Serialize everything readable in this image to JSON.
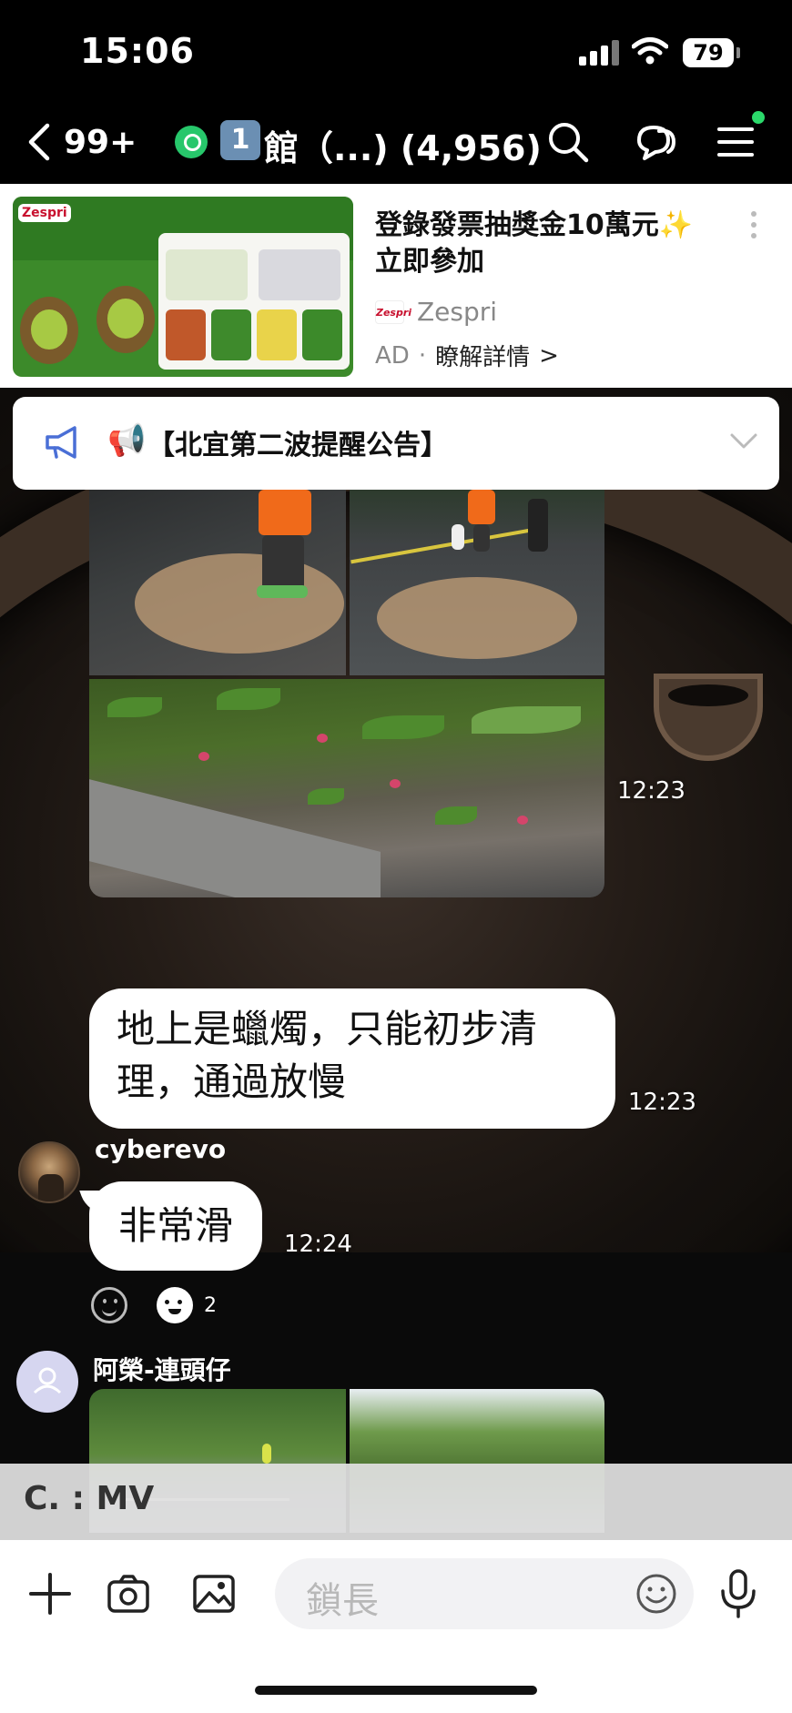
{
  "status_bar": {
    "time": "15:06",
    "battery": "79"
  },
  "header": {
    "back_count": "99+",
    "group_number": "1",
    "title": "館（...) (4,956)"
  },
  "ad": {
    "headline": "登錄發票抽獎金10萬元",
    "headline_emoji": "✨",
    "headline_line2": "立即參加",
    "brand_name": "Zespri",
    "brand_logo_text": "Zespri",
    "tag": "AD",
    "separator": "·",
    "more_label": "瞭解詳情",
    "more_chevron": ">"
  },
  "announcement": {
    "megaphone": "📢",
    "text": "【北宜第二波提醒公告】"
  },
  "messages": {
    "photo_time": "12:23",
    "text_msg": {
      "line1": "地上是蠟燭，只能初步清",
      "line2": "理，通過放慢",
      "time": "12:23"
    },
    "cyber": {
      "sender": "cyberevo",
      "text": "非常滑",
      "time": "12:24",
      "reaction_count": "2"
    },
    "ah_rong": {
      "sender": "阿榮-連頭仔"
    }
  },
  "quick_reply": {
    "label": "C. : MV"
  },
  "input": {
    "placeholder": "鎖長"
  },
  "colors": {
    "accent_green": "#27c76b",
    "bubble_white": "#ffffff",
    "ad_red": "#c8102e"
  },
  "icons": [
    "back-arrow-icon",
    "search-icon",
    "chat-bubbles-icon",
    "menu-icon",
    "megaphone-icon",
    "chevron-down-icon",
    "plus-icon",
    "camera-icon",
    "image-icon",
    "emoji-icon",
    "microphone-icon"
  ]
}
